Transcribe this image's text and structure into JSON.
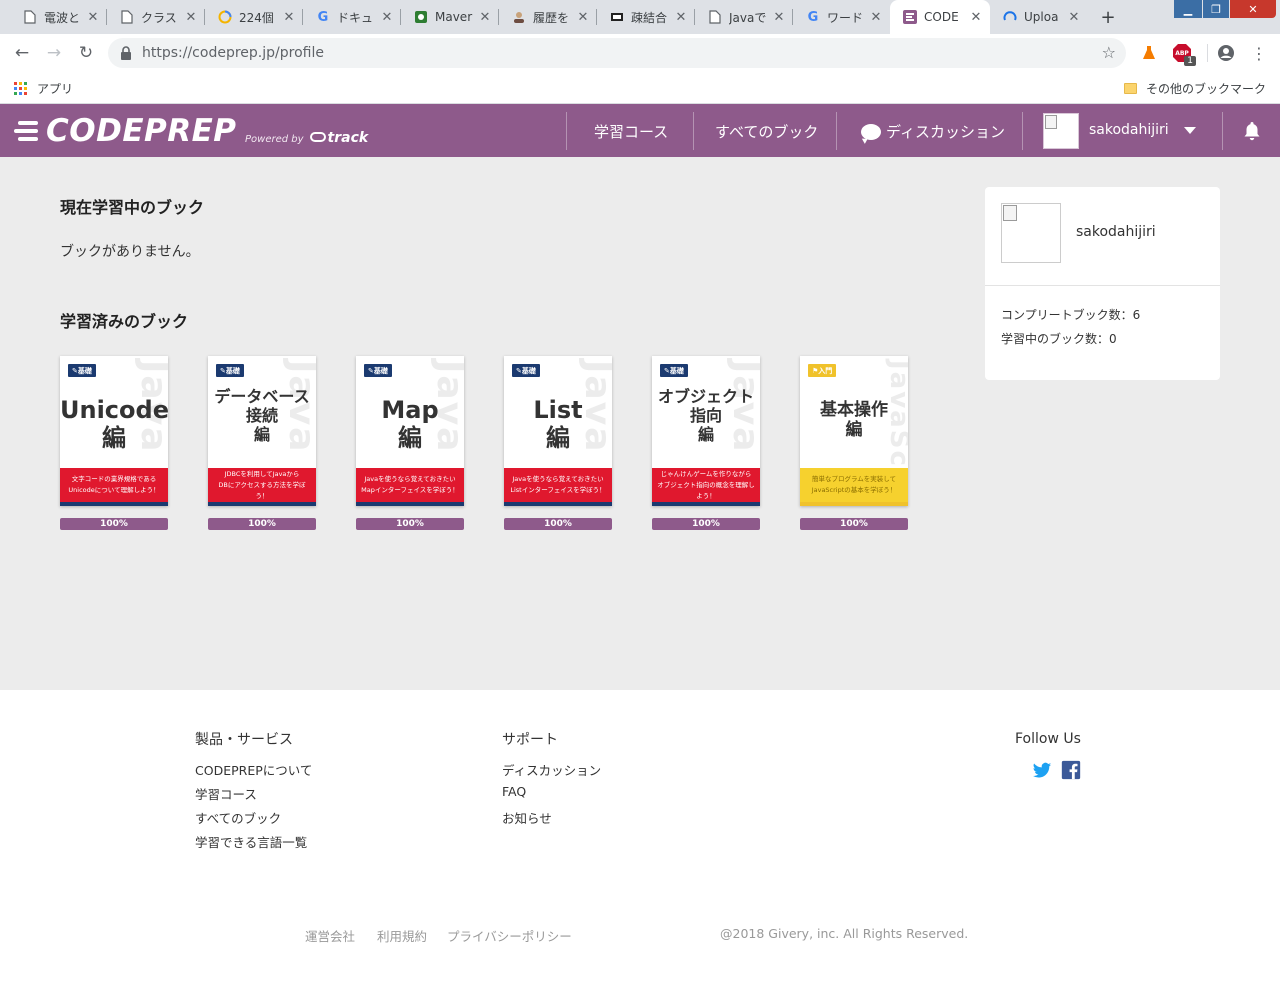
{
  "browser": {
    "tabs": [
      {
        "title": "電波と"
      },
      {
        "title": "クラス"
      },
      {
        "title": "224個"
      },
      {
        "title": "ドキュ"
      },
      {
        "title": "Maver"
      },
      {
        "title": "履歴を"
      },
      {
        "title": "疎結合"
      },
      {
        "title": "Javaで"
      },
      {
        "title": "ワード"
      },
      {
        "title": "CODE"
      },
      {
        "title": "Uploa"
      }
    ],
    "url_base": "https://codeprep.jp",
    "url_path": "/profile",
    "ext_badge": "1",
    "bookmarks": {
      "apps": "アプリ",
      "other": "その他のブックマーク"
    }
  },
  "header": {
    "logo": "CODEPREP",
    "powered_by": "Powered by",
    "track": "track",
    "nav": {
      "courses": "学習コース",
      "books": "すべてのブック",
      "discussion": "ディスカッション"
    },
    "username": "sakodahijiri"
  },
  "main": {
    "current_title": "現在学習中のブック",
    "current_empty": "ブックがありません。",
    "completed_title": "学習済みのブック",
    "books": [
      {
        "badge": "基礎",
        "watermark": "Java",
        "title": "Unicode\n編",
        "desc": "文字コードの業界規格である\nUnicodeについて理解しよう！",
        "progress": "100%"
      },
      {
        "badge": "基礎",
        "watermark": "Java",
        "title": "データベース\n接続\n編",
        "desc": "JDBCを利用してJavaから\nDBにアクセスする方法を学ぼう！",
        "progress": "100%"
      },
      {
        "badge": "基礎",
        "watermark": "Java",
        "title": "Map\n編",
        "desc": "Javaを使うなら覚えておきたい\nMapインターフェイスを学ぼう！",
        "progress": "100%"
      },
      {
        "badge": "基礎",
        "watermark": "Java",
        "title": "List\n編",
        "desc": "Javaを使うなら覚えておきたい\nListインターフェイスを学ぼう！",
        "progress": "100%"
      },
      {
        "badge": "基礎",
        "watermark": "Java",
        "title": "オブジェクト\n指向\n編",
        "desc": "じゃんけんゲームを作りながら\nオブジェクト指向の概念を理解しよう！",
        "progress": "100%"
      },
      {
        "badge": "入門",
        "watermark": "JavaScript",
        "title": "基本操作\n編",
        "desc": "簡単なプログラムを実装して\nJavaScriptの基本を学ぼう！",
        "progress": "100%"
      }
    ]
  },
  "profile_card": {
    "username": "sakodahijiri",
    "completed": "コンプリートブック数：6",
    "in_progress": "学習中のブック数：0"
  },
  "footer": {
    "products": {
      "title": "製品・サービス",
      "links": [
        "CODEPREPについて",
        "学習コース",
        "すべてのブック",
        "学習できる言語一覧"
      ]
    },
    "support": {
      "title": "サポート",
      "links": [
        "ディスカッション",
        "FAQ",
        "お知らせ"
      ]
    },
    "follow": "Follow Us",
    "bottom_links": [
      "運営会社",
      "利用規約",
      "プライバシーポリシー"
    ],
    "copyright": "@2018 Givery, inc. All Rights Reserved."
  },
  "colors": {
    "brand": "#8e5a8b",
    "main_bg": "#ececec",
    "book_red": "#e0182e",
    "book_navy": "#1b3a70",
    "book_yellow": "#f6d12e",
    "twitter": "#1da1f2",
    "facebook": "#3b5998"
  }
}
